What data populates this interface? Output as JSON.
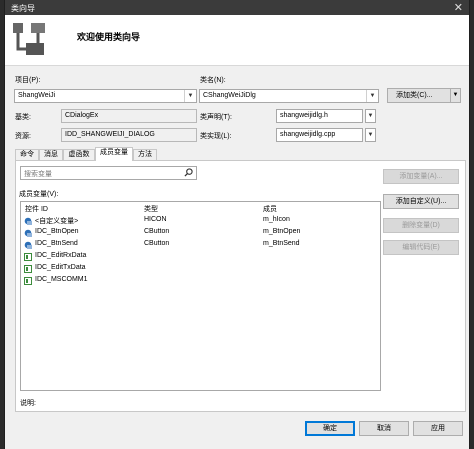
{
  "window": {
    "title": "类向导",
    "close_glyph": "✕"
  },
  "banner": {
    "heading": "欢迎使用类向导"
  },
  "project": {
    "label": "项目(P):",
    "value": "ShangWeiJi"
  },
  "classname": {
    "label": "类名(N):",
    "value": "CShangWeiJiDlg"
  },
  "add_class_button": "添加类(C)...",
  "base_class": {
    "label": "基类:",
    "value": "CDialogEx"
  },
  "class_declaration": {
    "label": "类声明(T):",
    "value": "shangweijidlg.h"
  },
  "resource": {
    "label": "资源:",
    "value": "IDD_SHANGWEIJI_DIALOG"
  },
  "class_impl": {
    "label": "类实现(L):",
    "value": "shangweijidlg.cpp"
  },
  "tabs": [
    {
      "label": "命令"
    },
    {
      "label": "消息"
    },
    {
      "label": "虚函数"
    },
    {
      "label": "成员变量"
    },
    {
      "label": "方法"
    }
  ],
  "search": {
    "placeholder": "搜索变量"
  },
  "members_label": "成员变量(V):",
  "list": {
    "headers": {
      "id": "控件 ID",
      "type": "类型",
      "member": "成员"
    },
    "rows": [
      {
        "id": "<自定义变量>",
        "type": "HICON",
        "member": "m_hIcon",
        "icon": "variable-icon"
      },
      {
        "id": "IDC_BtnOpen",
        "type": "CButton",
        "member": "m_BtnOpen",
        "icon": "variable-icon"
      },
      {
        "id": "IDC_BtnSend",
        "type": "CButton",
        "member": "m_BtnSend",
        "icon": "variable-icon"
      },
      {
        "id": "IDC_EditRxData",
        "type": "",
        "member": "",
        "icon": "control-icon"
      },
      {
        "id": "IDC_EditTxData",
        "type": "",
        "member": "",
        "icon": "control-icon"
      },
      {
        "id": "IDC_MSCOMM1",
        "type": "",
        "member": "",
        "icon": "control-icon"
      }
    ]
  },
  "side_buttons": {
    "add_variable": "添加变量(A)...",
    "add_custom": "添加自定义(U)...",
    "delete_variable": "删除变量(D)",
    "edit_code": "编辑代码(E)"
  },
  "description_label": "说明:",
  "footer": {
    "ok": "确定",
    "cancel": "取消",
    "apply": "应用"
  },
  "colors": {
    "accent": "#0078d7",
    "titlebar": "#3b3b3b",
    "window_bg": "#f0f0f0"
  }
}
